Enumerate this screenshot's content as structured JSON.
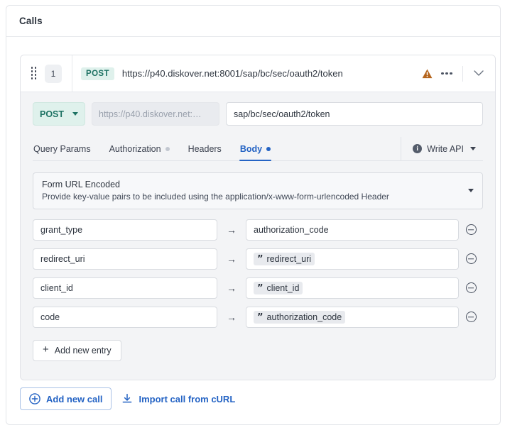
{
  "panel": {
    "title": "Calls"
  },
  "call": {
    "sequence": "1",
    "method_badge": "POST",
    "full_url": "https://p40.diskover.net:8001/sap/bc/sec/oauth2/token",
    "icons": {
      "drag": "drag-handle-icon",
      "warning": "warning-triangle-icon",
      "more": "more-options-icon",
      "collapse": "chevron-down-icon"
    },
    "request": {
      "method": "POST",
      "base_url_placeholder": "https://p40.diskover.net:…",
      "path_value": "sap/bc/sec/oauth2/token"
    },
    "tabs": [
      {
        "label": "Query Params",
        "active": false,
        "dot": "none"
      },
      {
        "label": "Authorization",
        "active": false,
        "dot": "grey"
      },
      {
        "label": "Headers",
        "active": false,
        "dot": "none"
      },
      {
        "label": "Body",
        "active": true,
        "dot": "blue"
      }
    ],
    "write_api": {
      "label": "Write API",
      "info_glyph": "i"
    },
    "body_type": {
      "title": "Form URL Encoded",
      "description": "Provide key-value pairs to be included using the application/x-www-form-urlencoded Header"
    },
    "entries": [
      {
        "key": "grant_type",
        "value": "authorization_code",
        "is_variable": false
      },
      {
        "key": "redirect_uri",
        "value": "redirect_uri",
        "is_variable": true
      },
      {
        "key": "client_id",
        "value": "client_id",
        "is_variable": true
      },
      {
        "key": "code",
        "value": "authorization_code",
        "is_variable": true
      }
    ],
    "arrow_glyph": "→",
    "variable_chip_glyph": "”",
    "add_entry_label": "Add new entry",
    "add_entry_glyph": "+"
  },
  "footer": {
    "add_call_label": "Add new call",
    "import_curl_label": "Import call from cURL"
  },
  "colors": {
    "accent_blue": "#2463c4",
    "method_teal": "#1d7263",
    "method_bg": "#dff1ec",
    "warning_amber": "#b5651d",
    "border": "#d8dbe0",
    "body_bg": "#f3f4f6"
  }
}
